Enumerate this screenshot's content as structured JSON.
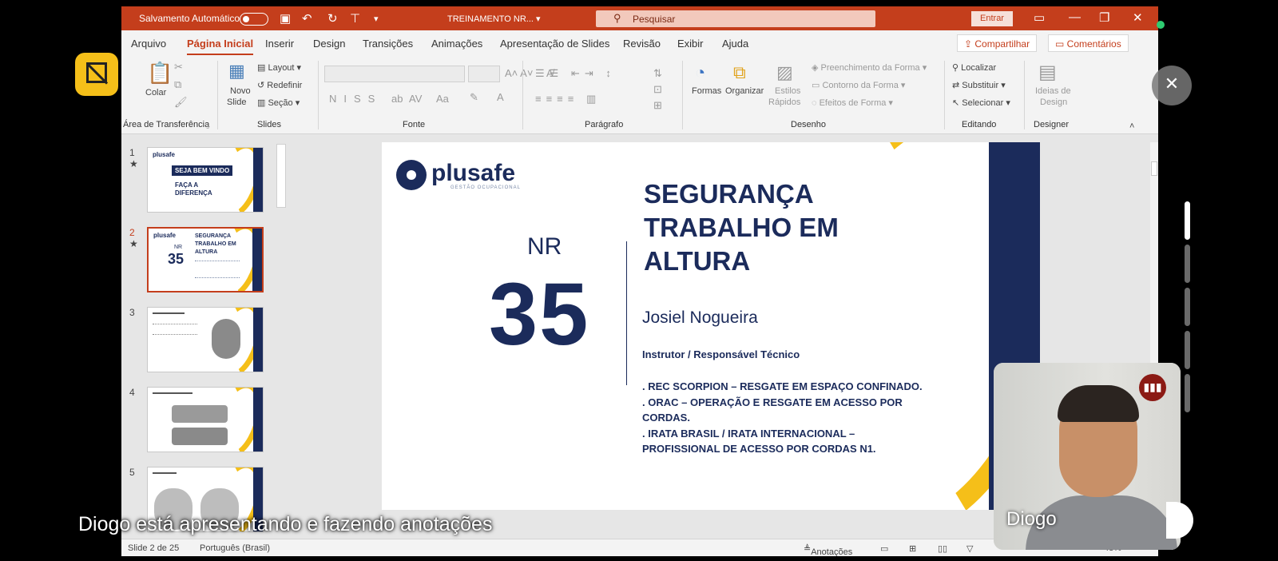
{
  "titlebar": {
    "autosave_label": "Salvamento Automático",
    "doc_title": "TREINAMENTO NR... ▾",
    "search_placeholder": "Pesquisar",
    "signin_label": "Entrar"
  },
  "menu": {
    "tabs": [
      "Arquivo",
      "Página Inicial",
      "Inserir",
      "Design",
      "Transições",
      "Animações",
      "Apresentação de Slides",
      "Revisão",
      "Exibir",
      "Ajuda"
    ],
    "active_tab": "Página Inicial",
    "share_label": "Compartilhar",
    "comments_label": "Comentários"
  },
  "ribbon": {
    "clipboard": {
      "paste_label": "Colar",
      "group_label": "Área de Transferência"
    },
    "slides": {
      "new_slide_line1": "Novo",
      "new_slide_line2": "Slide",
      "layout_label": "Layout",
      "reset_label": "Redefinir",
      "section_label": "Seção",
      "group_label": "Slides"
    },
    "font": {
      "group_label": "Fonte"
    },
    "paragraph": {
      "group_label": "Parágrafo"
    },
    "drawing": {
      "shapes_label": "Formas",
      "arrange_label": "Organizar",
      "quick_styles_line1": "Estilos",
      "quick_styles_line2": "Rápidos",
      "fill_label": "Preenchimento da Forma",
      "outline_label": "Contorno da Forma",
      "effects_label": "Efeitos de Forma",
      "group_label": "Desenho"
    },
    "editing": {
      "find_label": "Localizar",
      "replace_label": "Substituir",
      "select_label": "Selecionar",
      "group_label": "Editando"
    },
    "designer": {
      "ideas_line1": "Ideias de",
      "ideas_line2": "Design",
      "group_label": "Designer"
    }
  },
  "thumbnails": [
    {
      "number": "1",
      "star": "★",
      "line1": "SEJA BEM VINDO",
      "line2": "FAÇA A",
      "line3": "DIFERENÇA",
      "logo": "plusafe"
    },
    {
      "number": "2",
      "star": "★",
      "line1": "SEGURANÇA",
      "line2": "TRABALHO EM",
      "line3": "ALTURA",
      "logo": "plusafe",
      "nr": "NR",
      "num": "35"
    },
    {
      "number": "3"
    },
    {
      "number": "4"
    },
    {
      "number": "5"
    }
  ],
  "slide": {
    "logo": "plusafe",
    "logo_sub": "GESTÃO OCUPACIONAL",
    "nr_label": "NR",
    "nr_number": "35",
    "title_line1": "SEGURANÇA",
    "title_line2": "TRABALHO EM",
    "title_line3": "ALTURA",
    "presenter": "Josiel Nogueira",
    "role": "Instrutor / Responsável Técnico",
    "quals": [
      ". REC SCORPION – RESGATE EM ESPAÇO CONFINADO.",
      ". ORAC – OPERAÇÃO E RESGATE EM ACESSO POR CORDAS.",
      ". IRATA BRASIL / IRATA INTERNACIONAL – PROFISSIONAL DE ACESSO POR CORDAS N1."
    ]
  },
  "statusbar": {
    "slide_info": "Slide 2 de 25",
    "language": "Português (Brasil)",
    "notes_label": "Anotações",
    "zoom": "48%"
  },
  "meeting": {
    "caption": "Diogo está apresentando e fazendo anotações",
    "participant_name": "Diogo",
    "accent": "#f5bf19"
  }
}
